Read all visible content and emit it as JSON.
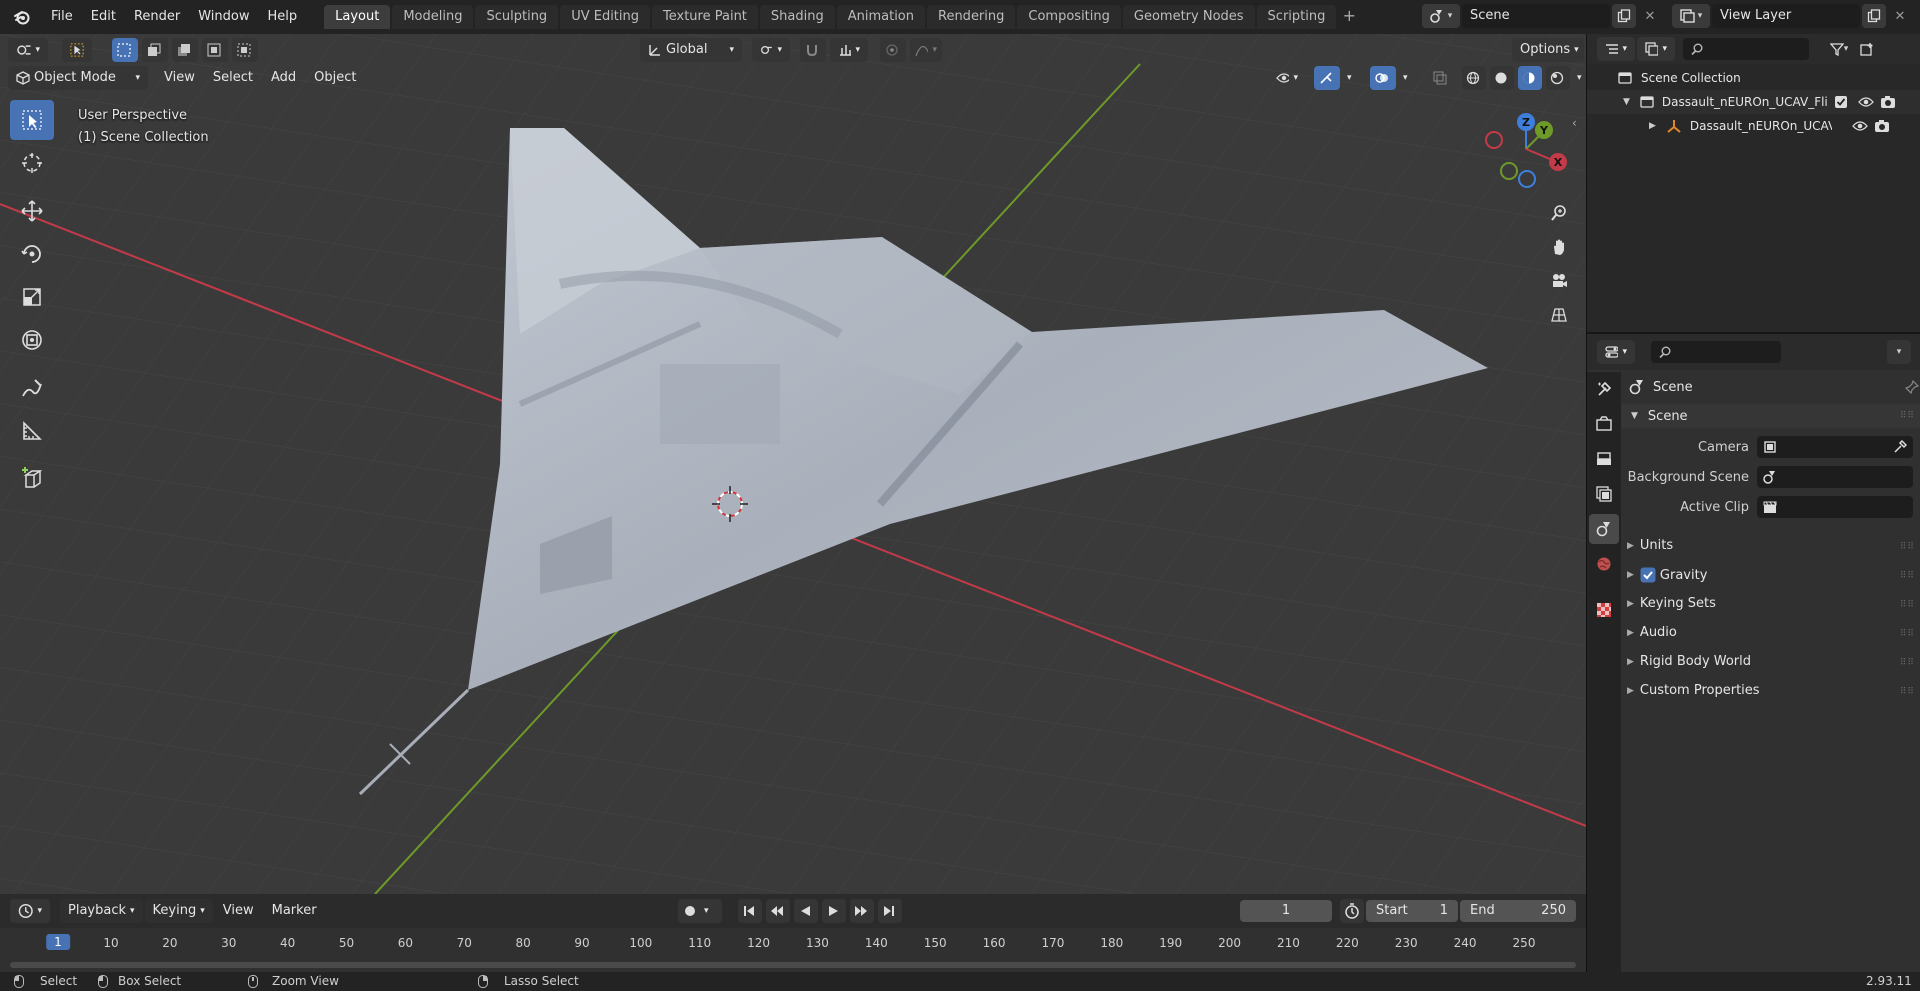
{
  "menus": [
    "File",
    "Edit",
    "Render",
    "Window",
    "Help"
  ],
  "workspace_tabs": [
    "Layout",
    "Modeling",
    "Sculpting",
    "UV Editing",
    "Texture Paint",
    "Shading",
    "Animation",
    "Rendering",
    "Compositing",
    "Geometry Nodes",
    "Scripting"
  ],
  "active_workspace": "Layout",
  "scene_name": "Scene",
  "view_layer": "View Layer",
  "viewport": {
    "mode": "Object Mode",
    "menus": [
      "View",
      "Select",
      "Add",
      "Object"
    ],
    "transform_orientation": "Global",
    "options_label": "Options",
    "perspective_label": "User Perspective",
    "collection_label": "(1) Scene Collection",
    "gizmo_axes": {
      "x": "X",
      "y": "Y",
      "z": "Z"
    }
  },
  "outliner": {
    "root": "Scene Collection",
    "collection": "Dassault_nEUROn_UCAV_Flig",
    "object": "Dassault_nEUROn_UCAV"
  },
  "properties": {
    "header_title": "Scene",
    "panel_title": "Scene",
    "fields": [
      {
        "label": "Camera"
      },
      {
        "label": "Background Scene"
      },
      {
        "label": "Active Clip"
      }
    ],
    "sections": [
      "Units",
      "Gravity",
      "Keying Sets",
      "Audio",
      "Rigid Body World",
      "Custom Properties"
    ],
    "gravity_checked": true
  },
  "timeline": {
    "menus": [
      "Playback",
      "Keying",
      "View",
      "Marker"
    ],
    "current_frame": "1",
    "start_label": "Start",
    "start_value": "1",
    "end_label": "End",
    "end_value": "250",
    "ruler_ticks": [
      "1",
      "10",
      "20",
      "30",
      "40",
      "50",
      "60",
      "70",
      "80",
      "90",
      "100",
      "110",
      "120",
      "130",
      "140",
      "150",
      "160",
      "170",
      "180",
      "190",
      "200",
      "210",
      "220",
      "230",
      "240",
      "250"
    ]
  },
  "statusbar": {
    "select": "Select",
    "box_select": "Box Select",
    "zoom_view": "Zoom View",
    "lasso_select": "Lasso Select",
    "version": "2.93.11"
  },
  "colors": {
    "accent": "#4772b3",
    "axis_x": "#c33a48",
    "axis_y": "#6e9a2a",
    "axis_z": "#3f7fdc"
  }
}
